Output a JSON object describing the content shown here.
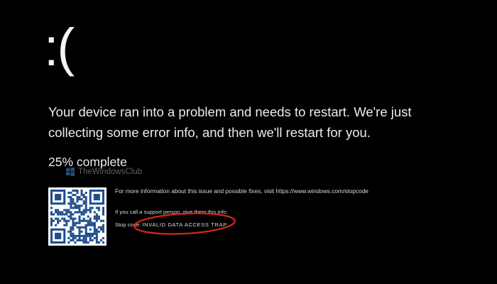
{
  "screen": {
    "sad_face": ":(",
    "message_line1": "Your device ran into a problem and needs to restart. We're just",
    "message_line2": "collecting some error info, and then we'll restart for you.",
    "progress_text": "25% complete",
    "more_info_text": "For more information about this issue and possible fixes, visit https://www.windows.com/stopcode",
    "support_text": "If you call a support person, give them this info:",
    "stop_code_label": "Stop code:",
    "stop_code_value": "INVALID DATA ACCESS TRAP"
  },
  "watermark": {
    "text": "TheWindowsClub"
  },
  "colors": {
    "background": "#000000",
    "text": "#ececec",
    "highlight_circle": "#d9261c"
  },
  "icons": {
    "qr": "qr-code-icon",
    "watermark_logo": "windows-club-logo-icon"
  }
}
